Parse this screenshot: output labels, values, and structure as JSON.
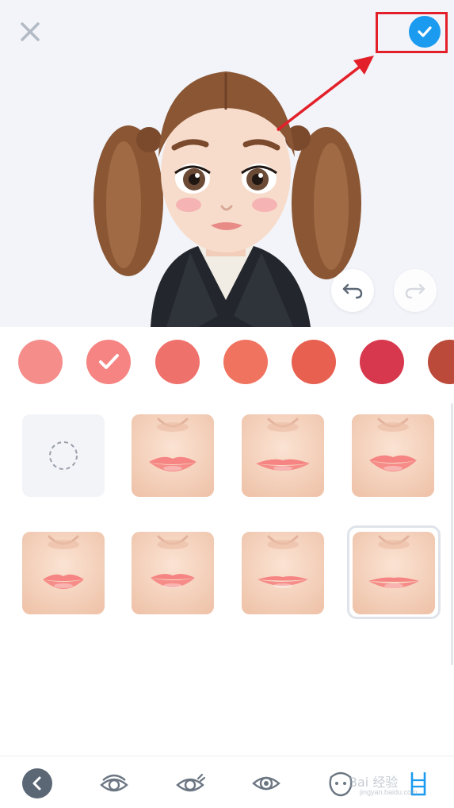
{
  "header": {
    "close_icon": "close-icon",
    "confirm_icon": "checkmark-icon",
    "accent": "#1a9bf0",
    "annotation_color": "#e3202a"
  },
  "preview": {
    "undo_icon": "undo-icon",
    "redo_icon": "redo-icon"
  },
  "palette": {
    "selected_index": 1,
    "colors": [
      "#f58e8b",
      "#f58482",
      "#ef716c",
      "#f0735f",
      "#e8604f",
      "#d8384e",
      "#bb4a3a"
    ]
  },
  "lip_styles": {
    "selected_index": 7,
    "items": [
      {
        "name": "none"
      },
      {
        "name": "lips-1"
      },
      {
        "name": "lips-2"
      },
      {
        "name": "lips-3"
      },
      {
        "name": "lips-4"
      },
      {
        "name": "lips-5"
      },
      {
        "name": "lips-6"
      },
      {
        "name": "lips-7"
      }
    ]
  },
  "bottom_nav": {
    "items": [
      "back-icon",
      "eye-lid-icon",
      "eyelash-icon",
      "eye-icon",
      "face-icon",
      "lips-icon"
    ],
    "active_color": "#1a9bf0"
  },
  "watermark": {
    "text": "Bai 经验",
    "sub": "jingyan.baidu.com"
  }
}
